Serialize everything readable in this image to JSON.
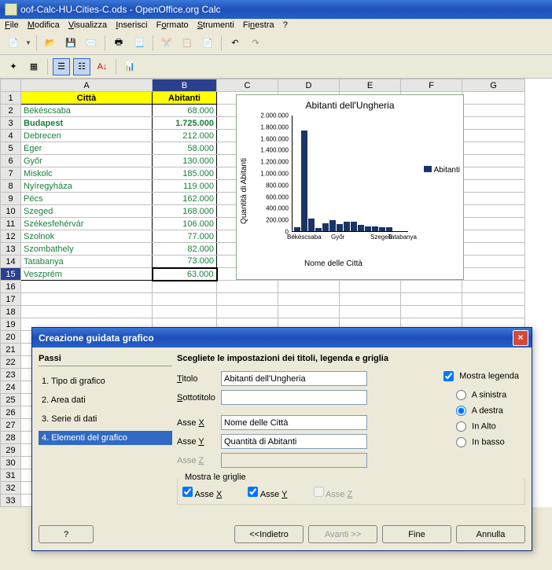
{
  "window": {
    "title": "oof-Calc-HU-Cities-C.ods - OpenOffice.org Calc"
  },
  "menu": {
    "file": "File",
    "modifica": "Modifica",
    "visualizza": "Visualizza",
    "inserisci": "Inserisci",
    "formato": "Formato",
    "strumenti": "Strumenti",
    "finestra": "Finestra",
    "help": "?"
  },
  "headers": {
    "a": "Città",
    "b": "Abitanti"
  },
  "cols": {
    "A": "A",
    "B": "B",
    "C": "C",
    "D": "D",
    "E": "E",
    "F": "F",
    "G": "G"
  },
  "rows": [
    {
      "n": "1"
    },
    {
      "n": "2",
      "city": "Békéscsaba",
      "pop": "68.000"
    },
    {
      "n": "3",
      "city": "Budapest",
      "pop": "1.725.000",
      "bold": true
    },
    {
      "n": "4",
      "city": "Debrecen",
      "pop": "212.000"
    },
    {
      "n": "5",
      "city": "Eger",
      "pop": "58.000"
    },
    {
      "n": "6",
      "city": "Győr",
      "pop": "130.000"
    },
    {
      "n": "7",
      "city": "Miskolc",
      "pop": "185.000"
    },
    {
      "n": "8",
      "city": "Nyíregyháza",
      "pop": "119.000"
    },
    {
      "n": "9",
      "city": "Pécs",
      "pop": "162.000"
    },
    {
      "n": "10",
      "city": "Szeged",
      "pop": "168.000"
    },
    {
      "n": "11",
      "city": "Székesfehérvár",
      "pop": "106.000"
    },
    {
      "n": "12",
      "city": "Szolnok",
      "pop": "77.000"
    },
    {
      "n": "13",
      "city": "Szombathely",
      "pop": "82.000"
    },
    {
      "n": "14",
      "city": "Tatabanya",
      "pop": "73.000"
    },
    {
      "n": "15",
      "city": "Veszprém",
      "pop": "63.000",
      "active": true
    },
    {
      "n": "16"
    },
    {
      "n": "17"
    },
    {
      "n": "18"
    },
    {
      "n": "19"
    },
    {
      "n": "20"
    },
    {
      "n": "21"
    },
    {
      "n": "22"
    },
    {
      "n": "23"
    },
    {
      "n": "24"
    },
    {
      "n": "25"
    },
    {
      "n": "26"
    },
    {
      "n": "27"
    },
    {
      "n": "28"
    },
    {
      "n": "29"
    },
    {
      "n": "30"
    },
    {
      "n": "31"
    },
    {
      "n": "32"
    },
    {
      "n": "33"
    }
  ],
  "chart_data": {
    "type": "bar",
    "title": "Abitanti dell'Ungheria",
    "xlabel": "Nome delle Città",
    "ylabel": "Quantità di Abitanti",
    "ylim": [
      0,
      2000000
    ],
    "categories": [
      "Békéscsaba",
      "Budapest",
      "Debrecen",
      "Eger",
      "Győr",
      "Miskolc",
      "Nyíregyháza",
      "Pécs",
      "Szeged",
      "Székesfehérvár",
      "Szolnok",
      "Szombathely",
      "Tatabanya",
      "Veszprém"
    ],
    "series": [
      {
        "name": "Abitanti",
        "values": [
          68000,
          1725000,
          212000,
          58000,
          130000,
          185000,
          119000,
          162000,
          168000,
          106000,
          77000,
          82000,
          73000,
          63000
        ]
      }
    ],
    "xticks_shown": [
      "Békéscsaba",
      "Győr",
      "Szeged",
      "Tatabanya"
    ],
    "yticks": [
      "0",
      "200.000",
      "400.000",
      "600.000",
      "800.000",
      "1.000.000",
      "1.200.000",
      "1.400.000",
      "1.600.000",
      "1.800.000",
      "2.000.000"
    ]
  },
  "dialog": {
    "title": "Creazione guidata grafico",
    "steps_hdr": "Passi",
    "steps": [
      "1. Tipo di grafico",
      "2. Area dati",
      "3. Serie di dati",
      "4. Elementi del grafico"
    ],
    "heading": "Scegliete le impostazioni dei titoli, legenda e griglia",
    "labels": {
      "titolo": "Titolo",
      "sottotitolo": "Sottotitolo",
      "assex": "Asse X",
      "assey": "Asse Y",
      "assez": "Asse Z",
      "mostra_griglie": "Mostra le griglie"
    },
    "values": {
      "titolo": "Abitanti dell'Ungheria",
      "sottotitolo": "",
      "assex": "Nome delle Città",
      "assey": "Quantità di Abitanti",
      "assez": ""
    },
    "legend": {
      "mostra": "Mostra legenda",
      "sinistra": "A sinistra",
      "destra": "A destra",
      "alto": "In Alto",
      "basso": "In basso"
    },
    "grid": {
      "x": "Asse X",
      "y": "Asse Y",
      "z": "Asse Z"
    },
    "buttons": {
      "help": "?",
      "back": "<<Indietro",
      "next": "Avanti >>",
      "finish": "Fine",
      "cancel": "Annulla"
    }
  }
}
